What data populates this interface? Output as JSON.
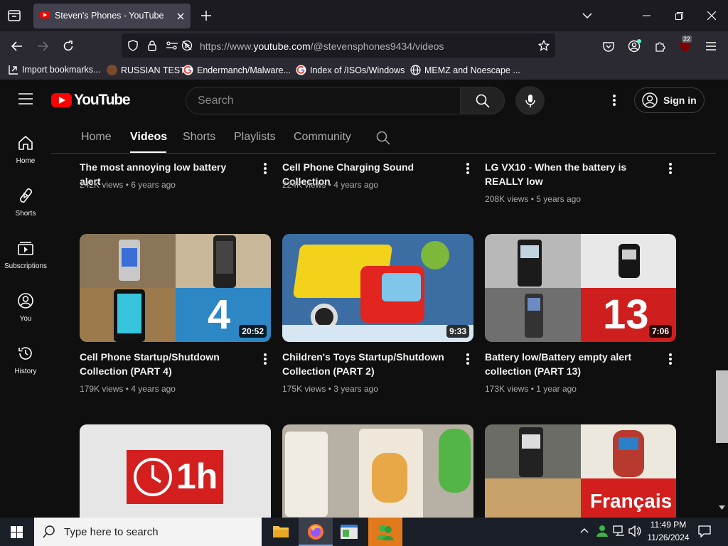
{
  "browser": {
    "tab_title": "Steven's Phones - YouTube",
    "url_prefix": "https://www.",
    "url_host": "youtube.com",
    "url_path": "/@stevensphones9434/videos",
    "extension_badge": "22",
    "bookmarks": [
      {
        "label": "Import bookmarks..."
      },
      {
        "label": "RUSSIAN TEST"
      },
      {
        "label": "Endermanch/Malware..."
      },
      {
        "label": "Index of /ISOs/Windows"
      },
      {
        "label": "MEMZ and Noescape ..."
      }
    ]
  },
  "youtube": {
    "logo_text": "YouTube",
    "search_placeholder": "Search",
    "signin_label": "Sign in",
    "sidebar": [
      {
        "label": "Home",
        "icon": "home-icon"
      },
      {
        "label": "Shorts",
        "icon": "shorts-icon"
      },
      {
        "label": "Subscriptions",
        "icon": "subscriptions-icon"
      },
      {
        "label": "You",
        "icon": "you-icon"
      },
      {
        "label": "History",
        "icon": "history-icon"
      }
    ],
    "channel_tabs": [
      "Home",
      "Videos",
      "Shorts",
      "Playlists",
      "Community"
    ],
    "active_tab": "Videos",
    "videos_row1": [
      {
        "title": "The most annoying low battery alert",
        "views": "242K views",
        "age": "6 years ago"
      },
      {
        "title": "Cell Phone Charging Sound Collection",
        "views": "224K views",
        "age": "4 years ago"
      },
      {
        "title": "LG VX10 - When the battery is REALLY low",
        "views": "208K views",
        "age": "5 years ago"
      }
    ],
    "videos_row2": [
      {
        "title": "Cell Phone Startup/Shutdown Collection (PART 4)",
        "views": "179K views",
        "age": "4 years ago",
        "duration": "20:52",
        "overlay": "4"
      },
      {
        "title": "Children's Toys Startup/Shutdown Collection (PART 2)",
        "views": "175K views",
        "age": "3 years ago",
        "duration": "9:33"
      },
      {
        "title": "Battery low/Battery empty alert collection (PART 13)",
        "views": "173K views",
        "age": "1 year ago",
        "duration": "7:06",
        "overlay": "13"
      }
    ],
    "videos_row3": [
      {
        "overlay": "1h"
      },
      {},
      {
        "overlay": "Français"
      }
    ],
    "meta_separator": "•"
  },
  "taskbar": {
    "search_placeholder": "Type here to search",
    "time": "11:49 PM",
    "date": "11/26/2024"
  },
  "colors": {
    "yt_red": "#ff0000",
    "bg": "#0f0f0f",
    "accent_blue": "#2f7fd6"
  }
}
